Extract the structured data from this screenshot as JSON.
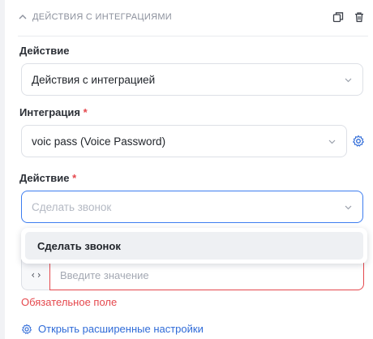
{
  "section": {
    "title": "ДЕЙСТВИЯ С ИНТЕГРАЦИЯМИ",
    "icons": [
      "chevron-up-icon",
      "copy-icon",
      "trash-icon"
    ]
  },
  "action_field": {
    "label": "Действие",
    "value": "Действия с интеграцией"
  },
  "integration_field": {
    "label": "Интеграция",
    "required_mark": "*",
    "value": "voic pass (Voice Password)"
  },
  "integration_action_field": {
    "label": "Действие",
    "required_mark": "*",
    "placeholder": "Сделать звонок",
    "options": [
      "Сделать звонок"
    ]
  },
  "value_input": {
    "code_toggle": "‹›",
    "placeholder": "Введите значение"
  },
  "error_text": "Обязательное поле",
  "advanced_link": "Открыть расширенные настройки",
  "colors": {
    "accent": "#3d7df0",
    "error": "#e5484d",
    "link": "#2f6bd8"
  }
}
